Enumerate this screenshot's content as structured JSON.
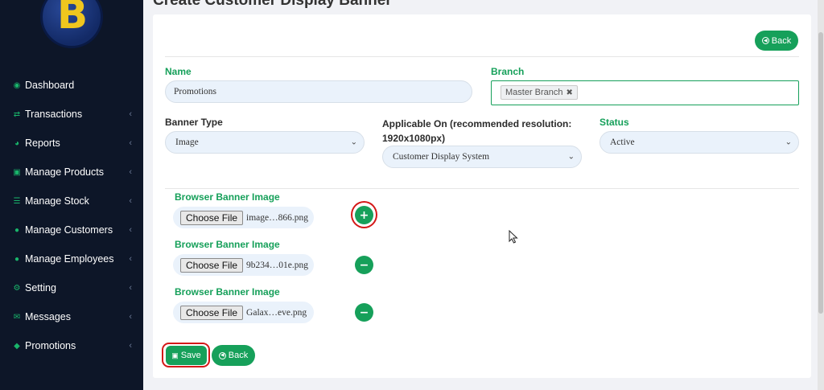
{
  "sidebar": {
    "logo_letter": "B",
    "items": [
      {
        "label": "Dashboard",
        "icon": "dashboard-icon"
      },
      {
        "label": "Transactions",
        "icon": "exchange-icon"
      },
      {
        "label": "Reports",
        "icon": "pie-chart-icon"
      },
      {
        "label": "Manage Products",
        "icon": "cube-icon"
      },
      {
        "label": "Manage Stock",
        "icon": "database-icon"
      },
      {
        "label": "Manage Customers",
        "icon": "users-icon"
      },
      {
        "label": "Manage Employees",
        "icon": "user-icon"
      },
      {
        "label": "Setting",
        "icon": "gears-icon"
      },
      {
        "label": "Messages",
        "icon": "envelope-icon"
      },
      {
        "label": "Promotions",
        "icon": "tag-icon"
      }
    ],
    "chevron": "‹"
  },
  "page": {
    "title": "Create Customer Display Banner"
  },
  "header": {
    "back_label": "Back"
  },
  "form": {
    "name_label": "Name",
    "name_value": "Promotions",
    "branch_label": "Branch",
    "branch_tag": "Master Branch",
    "banner_type_label": "Banner Type",
    "banner_type_value": "Image",
    "applicable_label_line1": "Applicable On (recommended resolution:",
    "applicable_label_line2": "1920x1080px)",
    "applicable_value": "Customer Display System",
    "status_label": "Status",
    "status_value": "Active"
  },
  "images": [
    {
      "label": "Browser Banner Image",
      "choose": "Choose File",
      "file": "image…866.png",
      "action": "+"
    },
    {
      "label": "Browser Banner Image",
      "choose": "Choose File",
      "file": "9b234…01e.png",
      "action": "−"
    },
    {
      "label": "Browser Banner Image",
      "choose": "Choose File",
      "file": "Galax…eve.png",
      "action": "−"
    }
  ],
  "footer": {
    "save_label": "Save",
    "back_label": "Back"
  },
  "colors": {
    "accent": "#16a05a",
    "sidebar": "#0d1628",
    "highlight": "#d41818"
  }
}
